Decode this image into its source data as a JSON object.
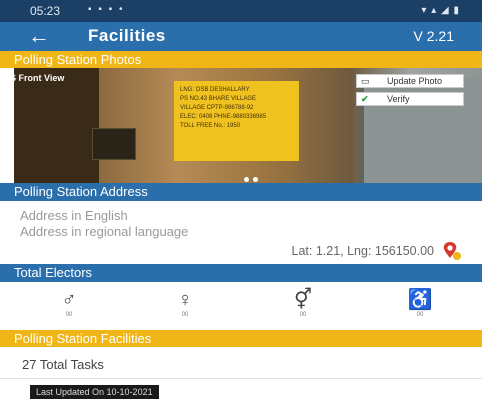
{
  "status_bar": {
    "time": "05:23",
    "notifications": "▪ ▪ ▪ •",
    "system": "▾ ▴ ◢ ▮"
  },
  "app_bar": {
    "back": "←",
    "title": "Facilities",
    "version": "V 2.21"
  },
  "photos": {
    "header": "Polling Station Photos",
    "caption": "PS Front View",
    "sign_lines": [
      "LNG: OSB DESHALLARY",
      "PS NO.43 BHARE VILLAGE",
      "VILLAGE CPTP-986788-92",
      "ELEC: 0408 PHNE-9880336985",
      "TOLL FREE No.: 1950"
    ],
    "update_button": "Update Photo",
    "verify_button": "Verify",
    "pager_dots": 2
  },
  "address": {
    "header": "Polling Station Address",
    "english_placeholder": "Address in English",
    "regional_placeholder": "Address in regional language",
    "latlng": "Lat: 1.21, Lng: 156150.00"
  },
  "electors": {
    "header": "Total Electors",
    "items": [
      {
        "icon": "male-elector-icon",
        "glyph": "♂",
        "count": "00"
      },
      {
        "icon": "female-elector-icon",
        "glyph": "♀",
        "count": "00"
      },
      {
        "icon": "third-gender-elector-icon",
        "glyph": "⚥",
        "count": "00"
      },
      {
        "icon": "pwd-elector-icon",
        "glyph": "♿",
        "count": "00"
      }
    ]
  },
  "facilities": {
    "header": "Polling Station Facilities",
    "tasks": "27 Total Tasks"
  },
  "toast": {
    "text": "Last Updated On 10-10-2021"
  }
}
